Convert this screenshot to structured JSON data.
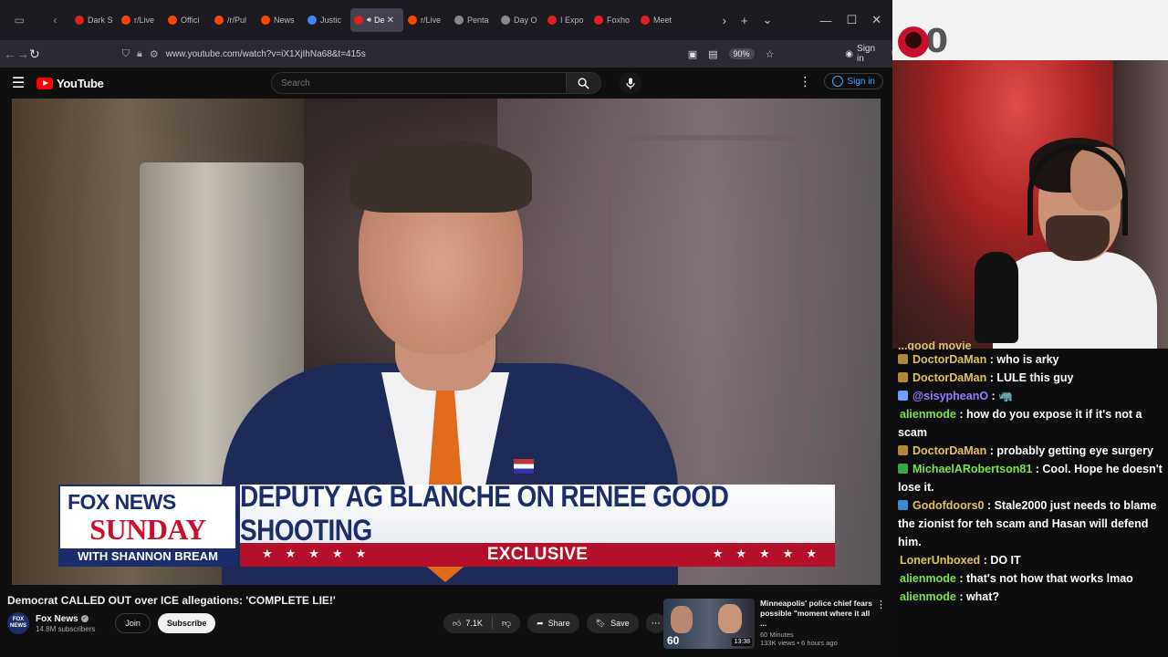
{
  "browser": {
    "tabs": [
      {
        "label": "Dark S",
        "color": "#e02020",
        "active": false
      },
      {
        "label": "r/Live",
        "color": "#ff4500",
        "active": false
      },
      {
        "label": "Offici",
        "color": "#ff4500",
        "active": false
      },
      {
        "label": "/r/Pul",
        "color": "#ff4500",
        "active": false
      },
      {
        "label": "News",
        "color": "#ff4500",
        "active": false
      },
      {
        "label": "Justic",
        "color": "#4285f4",
        "active": false
      },
      {
        "label": "De",
        "color": "#e02020",
        "active": true
      },
      {
        "label": "r/Live",
        "color": "#ff4500",
        "active": false
      },
      {
        "label": "Penta",
        "color": "#888888",
        "active": false
      },
      {
        "label": "Day O",
        "color": "#888888",
        "active": false
      },
      {
        "label": "I Expo",
        "color": "#e02020",
        "active": false
      },
      {
        "label": "Foxho",
        "color": "#e02020",
        "active": false
      },
      {
        "label": "Meet",
        "color": "#e02020",
        "active": false
      }
    ],
    "url": "www.youtube.com/watch?v=iX1XjIhNa68&t=415s",
    "zoom": "90%",
    "signin_label": "Sign in",
    "extension_badge": "13"
  },
  "youtube": {
    "logo_text": "YouTube",
    "search_placeholder": "Search",
    "signin_label": "Sign in"
  },
  "video": {
    "lower_third": {
      "brand_top": "FOX NEWS",
      "brand_show": "SUNDAY",
      "brand_host": "WITH SHANNON BREAM",
      "headline": "DEPUTY AG BLANCHE ON RENEE GOOD SHOOTING",
      "tag": "EXCLUSIVE"
    },
    "title": "Democrat CALLED OUT over ICE allegations: 'COMPLETE LIE!'",
    "channel": {
      "name": "Fox News",
      "avatar_text": "FOX NEWS",
      "subscribers": "14.8M subscribers"
    },
    "join_label": "Join",
    "subscribe_label": "Subscribe",
    "likes": "7.1K",
    "share_label": "Share",
    "save_label": "Save"
  },
  "recommended": {
    "title": "Minneapolis' police chief fears possible \"moment where it all ...",
    "channel": "60 Minutes",
    "meta": "133K views • 6 hours ago",
    "duration": "13:38",
    "thumb_logo": "60"
  },
  "stream": {
    "counter": "0",
    "partial_line": "...good movie",
    "chat": [
      {
        "user": "DoctorDaMan",
        "color": "#e0c060",
        "badge": "#b08a3a",
        "text": ": who is arky"
      },
      {
        "user": "DoctorDaMan",
        "color": "#e0c060",
        "badge": "#b08a3a",
        "text": ": LULE this guy"
      },
      {
        "user": "@sisypheanO",
        "color": "#8f7fff",
        "badge": "#6aa0ff",
        "text": ": 🦏"
      },
      {
        "user": "alienmode",
        "color": "#7ee04a",
        "badge": "",
        "text": ": how do you expose it if it's not a scam"
      },
      {
        "user": "DoctorDaMan",
        "color": "#e0c060",
        "badge": "#b08a3a",
        "text": ": probably getting eye surgery"
      },
      {
        "user": "MichaelARobertson81",
        "color": "#7ee04a",
        "badge": "#3aa84a",
        "text": ": Cool. Hope he doesn't lose it."
      },
      {
        "user": "Godofdoors0",
        "color": "#e0c060",
        "badge": "#3a8ad0",
        "text": ": Stale2000 just needs to blame the zionist for teh scam and Hasan will defend him."
      },
      {
        "user": "LonerUnboxed",
        "color": "#e0c060",
        "badge": "",
        "text": ": DO IT"
      },
      {
        "user": "alienmode",
        "color": "#7ee04a",
        "badge": "",
        "text": ": that's not how that works lmao"
      },
      {
        "user": "alienmode",
        "color": "#7ee04a",
        "badge": "",
        "text": ": what?"
      }
    ]
  }
}
